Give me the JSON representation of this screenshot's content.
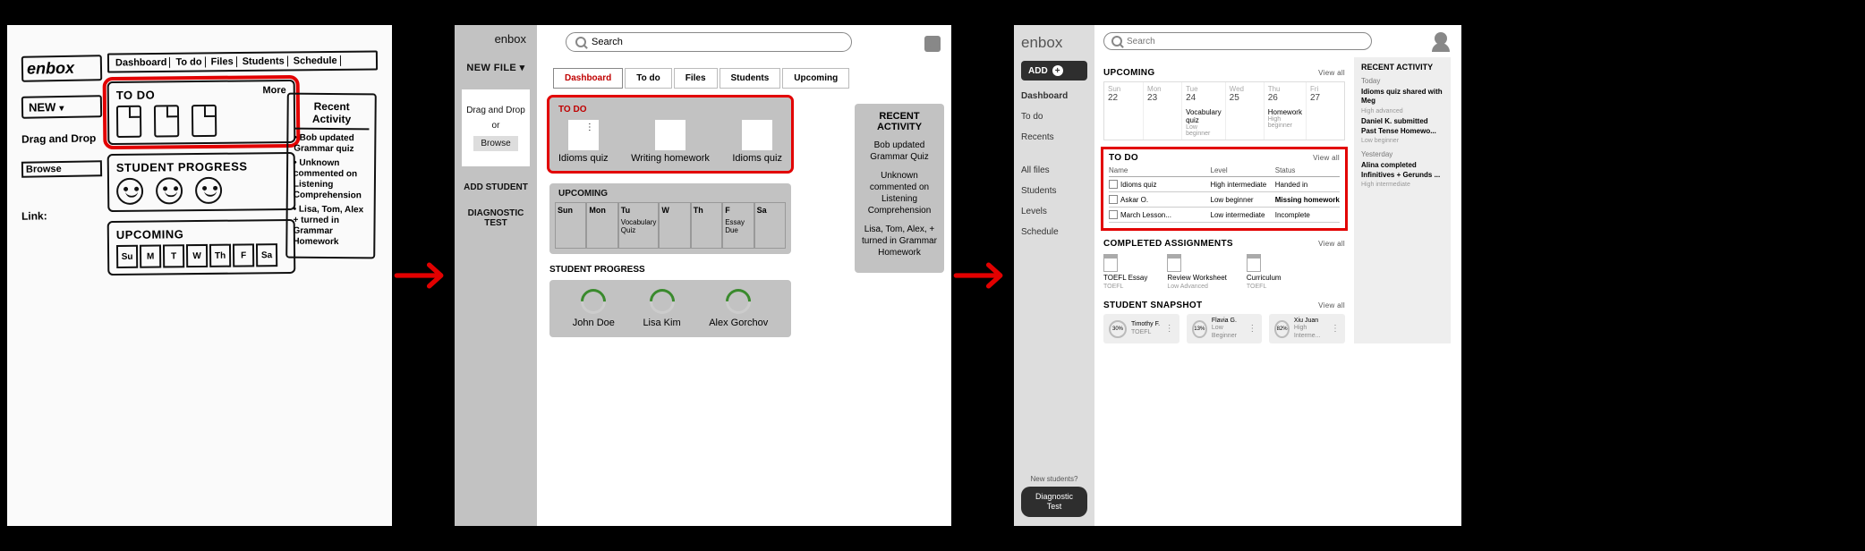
{
  "panel1_sketch": {
    "brand": "enbox",
    "new_btn": "NEW",
    "drag_label": "Drag and Drop",
    "browse_label": "Browse",
    "link_label": "Link:",
    "tabs": [
      "Dashboard",
      "To do",
      "Files",
      "Students",
      "Schedule"
    ],
    "todo": {
      "title": "To Do",
      "more": "More"
    },
    "student_progress": {
      "title": "Student Progress"
    },
    "upcoming": {
      "title": "Upcoming",
      "days": [
        "Su",
        "M",
        "T",
        "W",
        "Th",
        "F",
        "Sa"
      ]
    },
    "recent": {
      "title": "Recent Activity",
      "items": [
        "Bob updated Grammar quiz",
        "Unknown commented on Listening Comprehension",
        "Lisa, Tom, Alex + turned in Grammar Homework"
      ]
    }
  },
  "panel2": {
    "brand": "enbox",
    "side": {
      "new_file": "NEW FILE ▾",
      "drag": "Drag and Drop",
      "or": "or",
      "browse": "Browse",
      "add_student": "ADD STUDENT",
      "diagnostic": "DIAGNOSTIC TEST"
    },
    "search_placeholder": "Search",
    "tabs": [
      "Dashboard",
      "To do",
      "Files",
      "Students",
      "Upcoming"
    ],
    "todo": {
      "title": "TO DO",
      "items": [
        "Idioms quiz",
        "Writing homework",
        "Idioms quiz"
      ]
    },
    "upcoming": {
      "title": "UPCOMING",
      "days": [
        "Sun",
        "Mon",
        "Tu",
        "W",
        "Th",
        "F",
        "Sa"
      ],
      "tu_event": "Vocabulary Quiz",
      "f_event": "Essay Due"
    },
    "progress": {
      "title": "STUDENT PROGRESS",
      "students": [
        "John Doe",
        "Lisa Kim",
        "Alex Gorchov"
      ]
    },
    "recent": {
      "title": "RECENT ACTIVITY",
      "items": [
        "Bob updated Grammar Quiz",
        "Unknown commented on Listening Comprehension",
        "Lisa, Tom, Alex, + turned in Grammar Homework"
      ]
    }
  },
  "panel3": {
    "brand": "enbox",
    "add_btn": "ADD",
    "nav": [
      "Dashboard",
      "To do",
      "Recents"
    ],
    "nav2": [
      "All files",
      "Students",
      "Levels",
      "Schedule"
    ],
    "diag_q": "New students?",
    "diag_btn": "Diagnostic Test",
    "search_placeholder": "Search",
    "view_all": "View all",
    "upcoming": {
      "title": "UPCOMING",
      "days": [
        {
          "d": "Sun",
          "n": "22"
        },
        {
          "d": "Mon",
          "n": "23"
        },
        {
          "d": "Tue",
          "n": "24",
          "evt": "Vocabulary quiz",
          "sub": "Low beginner"
        },
        {
          "d": "Wed",
          "n": "25"
        },
        {
          "d": "Thu",
          "n": "26",
          "evt": "Homework",
          "sub": "High beginner"
        },
        {
          "d": "Fri",
          "n": "27"
        }
      ]
    },
    "todo": {
      "title": "TO DO",
      "headers": [
        "Name",
        "Level",
        "Status"
      ],
      "rows": [
        {
          "name": "Idioms quiz",
          "level": "High intermediate",
          "status": "Handed in"
        },
        {
          "name": "Askar O.",
          "level": "Low beginner",
          "status": "Missing homework",
          "bold": true
        },
        {
          "name": "March Lesson...",
          "level": "Low intermediate",
          "status": "Incomplete"
        }
      ]
    },
    "completed": {
      "title": "COMPLETED ASSIGNMENTS",
      "items": [
        {
          "t": "TOEFL Essay",
          "s": "TOEFL"
        },
        {
          "t": "Review Worksheet",
          "s": "Low Advanced"
        },
        {
          "t": "Curriculum",
          "s": "TOEFL"
        }
      ]
    },
    "snapshot": {
      "title": "STUDENT SNAPSHOT",
      "items": [
        {
          "pct": "30%",
          "name": "Timothy F.",
          "sub": "TOEFL"
        },
        {
          "pct": "13%",
          "name": "Flavia G.",
          "sub": "Low Beginner"
        },
        {
          "pct": "82%",
          "name": "Xiu Juan",
          "sub": "High Interme..."
        }
      ]
    },
    "recent": {
      "title": "RECENT ACTIVITY",
      "groups": [
        {
          "label": "Today",
          "items": [
            {
              "t": "Idioms quiz shared with Meg",
              "s": "High advanced"
            },
            {
              "t": "Daniel K. submitted Past Tense Homewo...",
              "s": "Low beginner"
            }
          ]
        },
        {
          "label": "Yesterday",
          "items": [
            {
              "t": "Alina completed Infinitives + Gerunds ...",
              "s": "High intermediate"
            }
          ]
        }
      ]
    }
  }
}
